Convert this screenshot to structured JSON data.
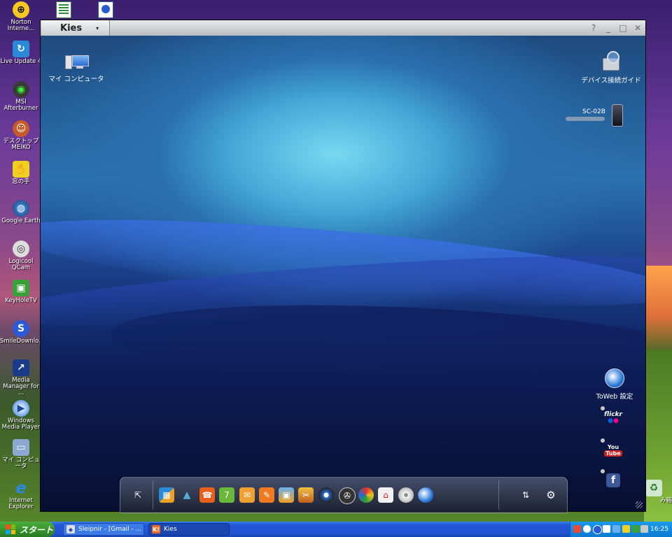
{
  "desktop": {
    "icons": [
      {
        "label": "Norton Interne..."
      },
      {
        "label": "Live Update 4"
      },
      {
        "label": "MSI Afterburner"
      },
      {
        "label": "デスクトップ MEIKO"
      },
      {
        "label": "窓の手"
      },
      {
        "label": "Google Earth"
      },
      {
        "label": "Logicool QCam"
      },
      {
        "label": "KeyHoleTV"
      },
      {
        "label": "SmileDownlo..."
      },
      {
        "label": "Media Manager for ..."
      },
      {
        "label": "Windows Media Player"
      },
      {
        "label": "マイ コンピュータ"
      },
      {
        "label": "Internet Explorer"
      },
      {
        "label": "み箱"
      }
    ]
  },
  "kies": {
    "title": "Kies",
    "dropdown_glyph": "▾",
    "controls": {
      "help": "?",
      "minimize": "_",
      "maximize": "□",
      "close": "✕"
    },
    "my_computer_label": "マイ コンピュータ",
    "device_guide_label": "デバイス接続ガイド",
    "device_name": "SC-02B",
    "toweb_label": "ToWeb 設定",
    "services": {
      "flickr": "flickr",
      "youtube_top": "You",
      "youtube_bottom": "Tube",
      "facebook": "f"
    },
    "dock_icons": [
      "export-icon",
      "apps-icon",
      "tree-icon",
      "phone-icon",
      "calendar-icon",
      "email-icon",
      "memo-icon",
      "photo-icon",
      "photo-edit-icon",
      "music-icon",
      "video-icon",
      "podcast-icon",
      "store-icon",
      "disc-icon",
      "globe-icon",
      "sync-icon",
      "settings-icon"
    ],
    "calendar_day": "7"
  },
  "taskbar": {
    "start_label": "スタート",
    "tasks": [
      {
        "label": "Sleipnir - [Gmail - ..."
      },
      {
        "label": "Kies",
        "icon_text": "K!"
      }
    ],
    "clock": "16:25"
  }
}
